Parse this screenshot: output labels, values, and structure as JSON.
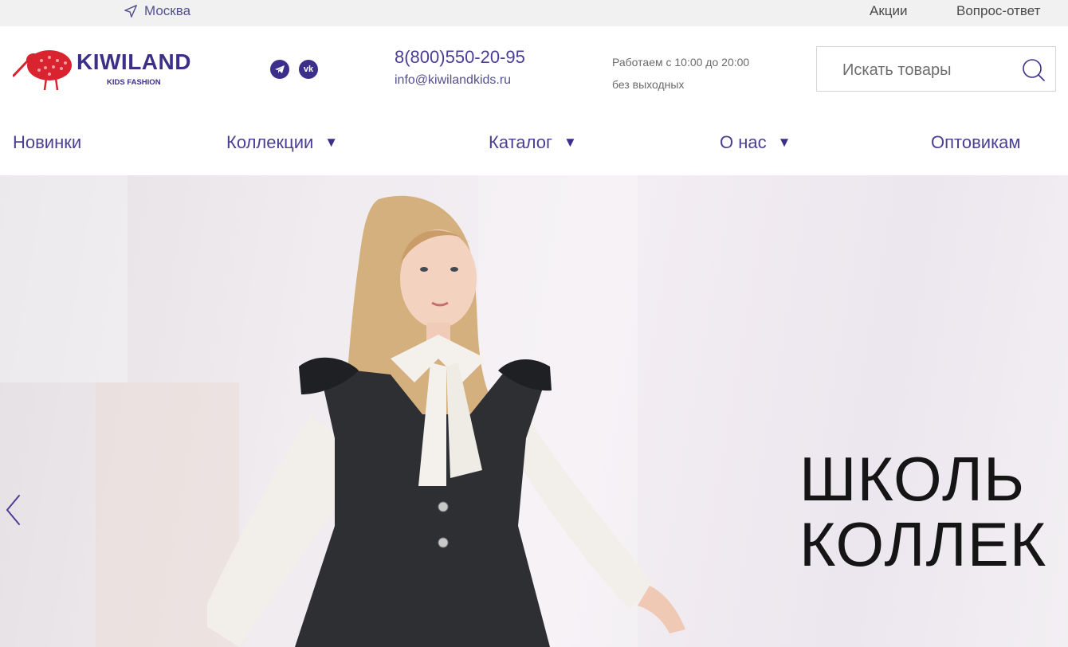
{
  "topbar": {
    "city": "Москва",
    "links": [
      "Акции",
      "Вопрос-ответ"
    ]
  },
  "logo": {
    "name": "KIWILAND",
    "tagline": "KIDS FASHION"
  },
  "social": [
    "telegram-icon",
    "vk-icon"
  ],
  "contacts": {
    "phone": "8(800)550-20-95",
    "email": "info@kiwilandkids.ru",
    "hours": "Работаем с 10:00 до 20:00 без выходных"
  },
  "search": {
    "placeholder": "Искать товары"
  },
  "nav": [
    "Новинки",
    "Коллекции",
    "Каталог",
    "О нас",
    "Оптовикам"
  ],
  "hero": {
    "title": "ШКОЛЬ\nКОЛЛЕК"
  },
  "colors": {
    "brand": "#3b2f8a",
    "accent_red": "#d9232e"
  }
}
